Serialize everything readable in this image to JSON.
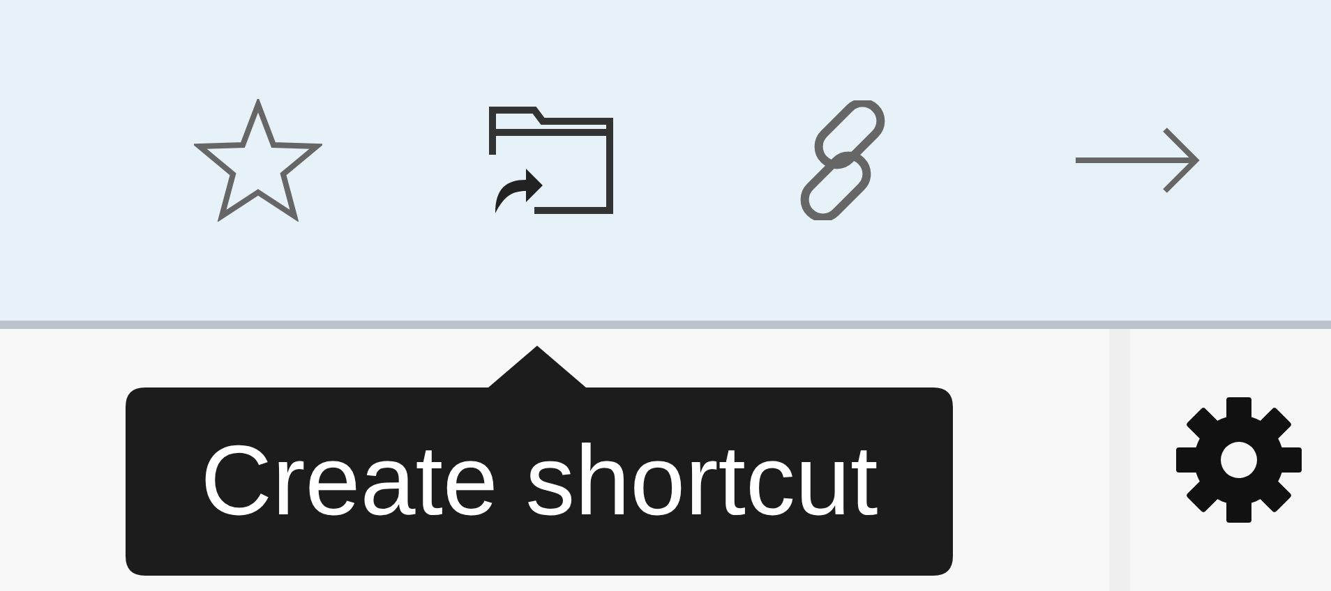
{
  "tooltip": {
    "text": "Create shortcut"
  }
}
